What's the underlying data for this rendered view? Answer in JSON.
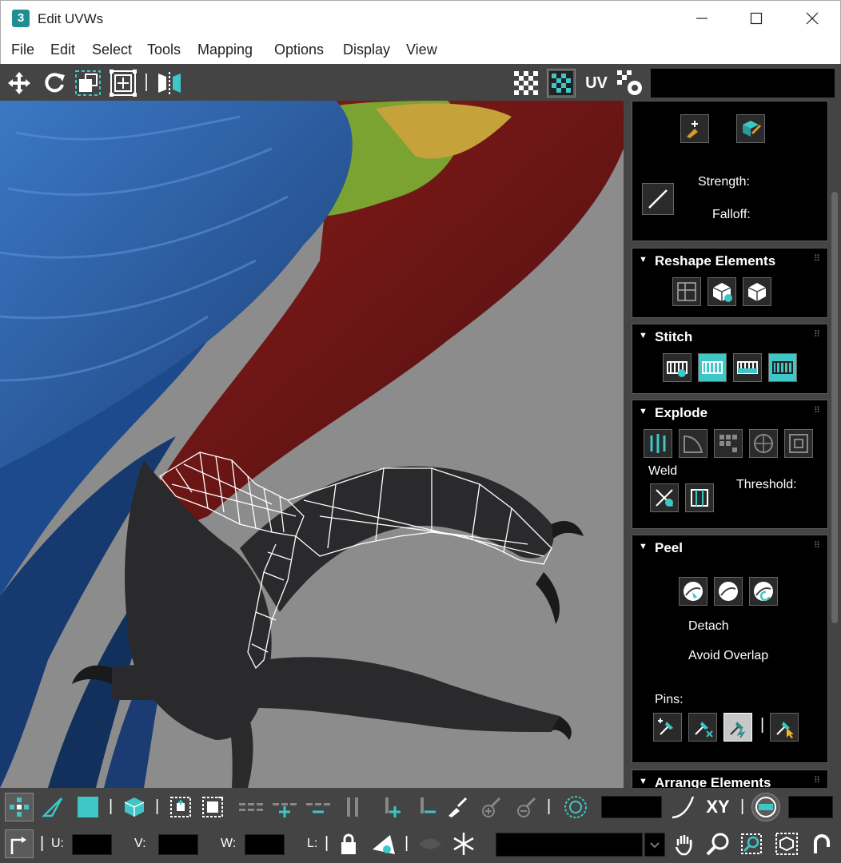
{
  "window": {
    "app_icon": "3",
    "title": "Edit UVWs",
    "minimize_icon": "minimize-icon",
    "maximize_icon": "maximize-icon",
    "close_icon": "close-icon"
  },
  "menu": {
    "items": [
      "File",
      "Edit",
      "Select",
      "Tools",
      "Mapping",
      "Options",
      "Display",
      "View"
    ]
  },
  "toolbar": {
    "uv_label": "UV",
    "icons": [
      "move-icon",
      "rotate-icon",
      "scale-icon",
      "freeform-icon",
      "mirror-icon",
      "checker-grid-icon",
      "checker-texture-icon",
      "uv-label",
      "uv-settings-icon"
    ]
  },
  "panel": {
    "paint": {
      "strength_label": "Strength:",
      "falloff_label": "Falloff:"
    },
    "reshape": {
      "title": "Reshape Elements"
    },
    "stitch": {
      "title": "Stitch"
    },
    "explode": {
      "title": "Explode",
      "weld_label": "Weld",
      "threshold_label": "Threshold:"
    },
    "peel": {
      "title": "Peel",
      "detach_label": "Detach",
      "avoid_overlap_label": "Avoid Overlap",
      "pins_label": "Pins:"
    },
    "arrange": {
      "title": "Arrange Elements"
    }
  },
  "bottom": {
    "xy_label": "XY",
    "u_label": "U:",
    "v_label": "V:",
    "w_label": "W:",
    "l_label": "L:"
  },
  "colors": {
    "accent": "#3fc6c6",
    "panel_bg": "#444444",
    "rollout_bg": "#000000",
    "viewport_bg": "#8c8c8c",
    "parrot_blue": "#2e64b0",
    "parrot_red": "#7a1a18",
    "parrot_green": "#7aa332",
    "claw_dark": "#2a2a2c"
  }
}
